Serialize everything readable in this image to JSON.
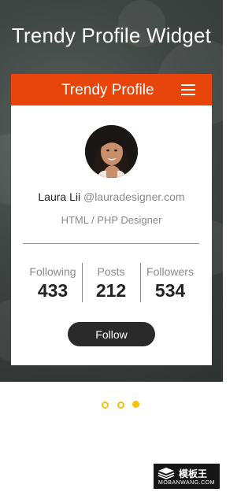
{
  "page": {
    "title": "Trendy Profile Widget"
  },
  "card": {
    "title": "Trendy Profile",
    "menu_icon": "hamburger-menu-icon",
    "accent_color": "#e8450a"
  },
  "profile": {
    "name": "Laura Lii",
    "handle": "@lauradesigner.com",
    "role": "HTML / PHP Designer"
  },
  "stats": [
    {
      "label": "Following",
      "value": "433"
    },
    {
      "label": "Posts",
      "value": "212"
    },
    {
      "label": "Followers",
      "value": "534"
    }
  ],
  "follow_button": {
    "label": "Follow"
  },
  "carousel": {
    "dot_count": 3,
    "active_index": 2,
    "dot_color": "#f2c20c"
  },
  "watermark": {
    "brand": "模板王",
    "url": "MOBANWANG.COM"
  }
}
